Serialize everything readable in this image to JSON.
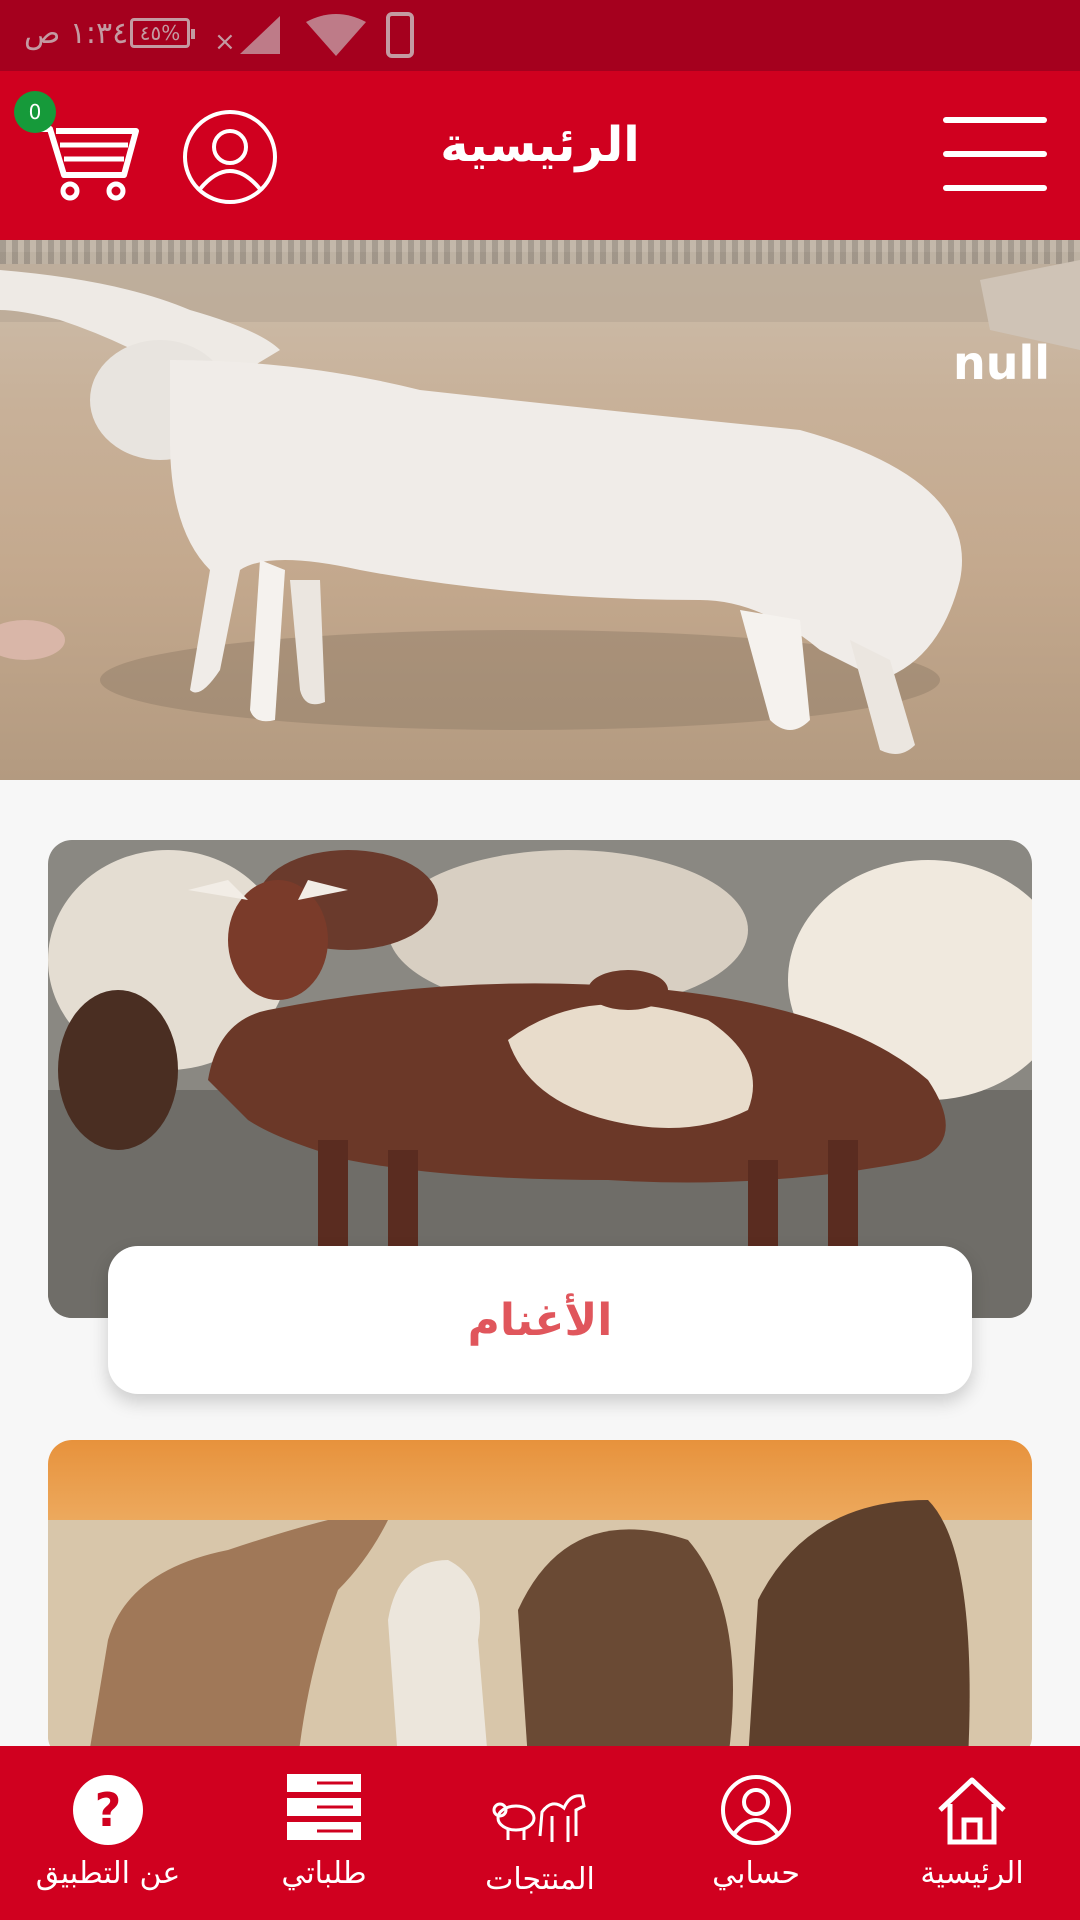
{
  "status_bar": {
    "time": "١:٣٤ ص",
    "battery": "٤٥%"
  },
  "header": {
    "title": "الرئيسية",
    "cart_count": "0"
  },
  "hero": {
    "label": "null"
  },
  "categories": [
    {
      "label": "الأغنام"
    },
    {
      "label": ""
    }
  ],
  "bottom_nav": {
    "items": [
      {
        "label": "الرئيسية",
        "icon": "home-icon"
      },
      {
        "label": "حسابي",
        "icon": "user-icon"
      },
      {
        "label": "المنتجات",
        "icon": "livestock-icon"
      },
      {
        "label": "طلباتي",
        "icon": "orders-icon"
      },
      {
        "label": "عن التطبيق",
        "icon": "help-icon"
      }
    ]
  },
  "colors": {
    "primary": "#d0001f",
    "status_bar": "#a5001e",
    "badge": "#169a3a",
    "caption_text": "#e0565c"
  }
}
